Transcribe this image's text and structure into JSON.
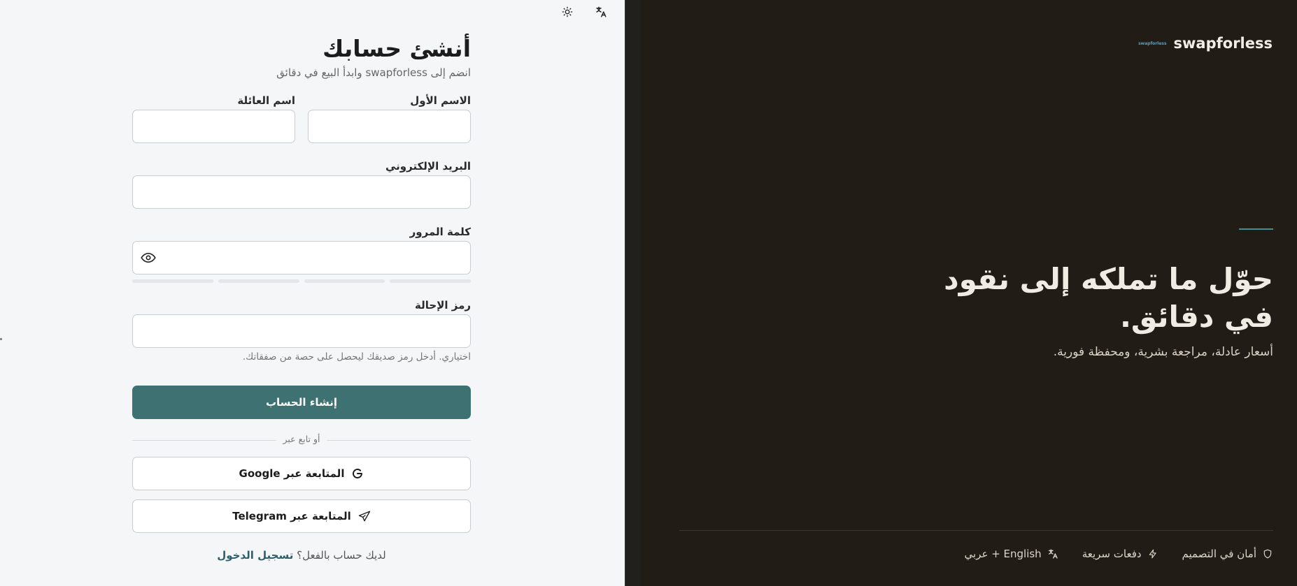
{
  "toolbar": {
    "theme_icon": "sun-icon",
    "language_icon": "translate-icon"
  },
  "form": {
    "title": "أنشئ حسابك",
    "subtitle": "انضم إلى swapforless وابدأ البيع في دقائق",
    "first_name_label": "الاسم الأول",
    "last_name_label": "اسم العائلة",
    "first_name_value": "",
    "last_name_value": "",
    "email_label": "البريد الإلكتروني",
    "email_value": "",
    "password_label": "كلمة المرور",
    "password_value": "",
    "password_strength_filled": 0,
    "referral_label": "رمز الإحالة",
    "referral_value": "",
    "referral_hint": "اختياري. أدخل رمز صديقك ليحصل على حصة من صفقاتك.",
    "submit_label": "إنشاء الحساب",
    "divider_text": "أو تابع عبر",
    "google_label": "المتابعة عبر Google",
    "telegram_label": "المتابعة عبر Telegram",
    "signin_prompt": "لديك حساب بالفعل؟",
    "signin_link": "تسجيل الدخول"
  },
  "hero": {
    "brand_name": "swapforless",
    "brand_logo_text": "swapforless",
    "title": "حوّل ما تملكه إلى نقود في دقائق.",
    "subtitle": "أسعار عادلة، مراجعة بشرية، ومحفظة فورية.",
    "features": [
      {
        "icon": "shield-icon",
        "label": "أمان في التصميم"
      },
      {
        "icon": "bolt-icon",
        "label": "دفعات سريعة"
      },
      {
        "icon": "translate-icon",
        "label": "English + عربي"
      }
    ]
  },
  "colors": {
    "primary": "#3e7272",
    "accent": "#3f8f93",
    "hero_bg": "#221c16",
    "form_bg": "#f5f6f8",
    "link": "#2e5f6a"
  }
}
